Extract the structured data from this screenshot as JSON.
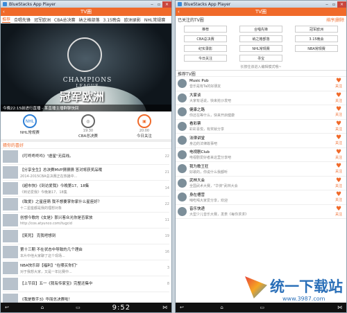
{
  "left": {
    "window_title": "BlueStacks App Player",
    "app_title": "TV圈",
    "tabs": [
      "推荐",
      "合唱先锋",
      "冠军欧洲",
      "CBA总决赛",
      "纳之格部落",
      "3.15晚会",
      "欧洲录影",
      "NHL常规赛"
    ],
    "banner": {
      "big_text": "冠军欧洲",
      "caption": "今晚22:15前进行直播 - 某直播主播群聊快回"
    },
    "categories": [
      {
        "label": "NHL常规赛",
        "time": ""
      },
      {
        "label": "CBA总决赛",
        "time": "19:30"
      },
      {
        "label": "今日关注",
        "time": "20:00"
      }
    ],
    "feed_header": "猜你的喜好",
    "feed": [
      {
        "t": "《叮咚咚咚吟》\"虐星\"无底线。",
        "s": "",
        "c": "22"
      },
      {
        "t": "【分享全生】总决赛MVP猜猜猜 答对将获奖品哦",
        "s": "2014-2015CBA总决赛正在热播中...",
        "c": "21"
      },
      {
        "t": "《超市快》《到访爱我》今晚第17、18集",
        "s": "《到访爱我》今晚第17、18集",
        "c": "14"
      },
      {
        "t": "《致爱》之星座萌 我不想要掌你家什么星座好？",
        "s": "十二星座都是我的理想对象",
        "c": "22"
      },
      {
        "t": "创想今歌的《女是》那兴客众光你是否家放",
        "s": "http://cos.atyunco.com/tugcid",
        "c": "11"
      },
      {
        "t": "【笑死】 克我吧想到",
        "s": "",
        "c": "19"
      },
      {
        "t": "第十三期 不在状态中导致的几个理由",
        "s": "本片中他大家聊了这个现场...",
        "c": "16"
      },
      {
        "t": "NBA快乐部【福利】\"在哪买你们\"",
        "s": "对于我想大家，又是一年比赛中...",
        "c": "3"
      },
      {
        "t": "【上节目】五一《我有传家宝》完整还集中",
        "s": "",
        "c": "8"
      },
      {
        "t": "《我是歌手3》华丽总决赛啦！",
        "s": "",
        "c": ""
      }
    ],
    "clock": "9:52"
  },
  "right": {
    "window_title": "BlueStacks App Player",
    "app_title": "TV圈",
    "attention_label": "已关注的TV圈",
    "attention_link": "排序|删除",
    "grid": [
      "推荐",
      "合唱先锋",
      "冠军欧洲",
      "CBA总决赛",
      "纳之格部落",
      "3.15晚会",
      "纪实录影",
      "NHL常规赛",
      "NBA常规赛",
      "今日关注",
      "寻宝",
      ""
    ],
    "more_hint": "长按住该进入编辑模式哦~",
    "rec_header": "推荐TV圈",
    "follow": "关注",
    "channels": [
      {
        "n": "Music Pub",
        "s": "音乐是有Ta的好朋友"
      },
      {
        "n": "大家谈",
        "s": "大家有话说，快来抢沙发吧"
      },
      {
        "n": "健康之路",
        "s": "你还在等什么，快来开启健康"
      },
      {
        "n": "看彩票",
        "s": "彩彩喜悦，有奖就分享"
      },
      {
        "n": "法律讲堂",
        "s": "身边的法律故事吧"
      },
      {
        "n": "电视剧Club",
        "s": "电视剧爱好者来这里分享吧"
      },
      {
        "n": "我为歌王狂",
        "s": "好歌的，你说什么我都听"
      },
      {
        "n": "武林大会",
        "s": "全国武术大赛，\"华侠\"武林大会"
      },
      {
        "n": "身在槽营",
        "s": "咱吃喝大家爱分享，欢迎"
      },
      {
        "n": "音乐快递",
        "s": "大型少儿音乐大赛，发表《每你求求》"
      }
    ],
    "watermark": {
      "title": "统一下载站",
      "url": "www.3987.com"
    }
  }
}
